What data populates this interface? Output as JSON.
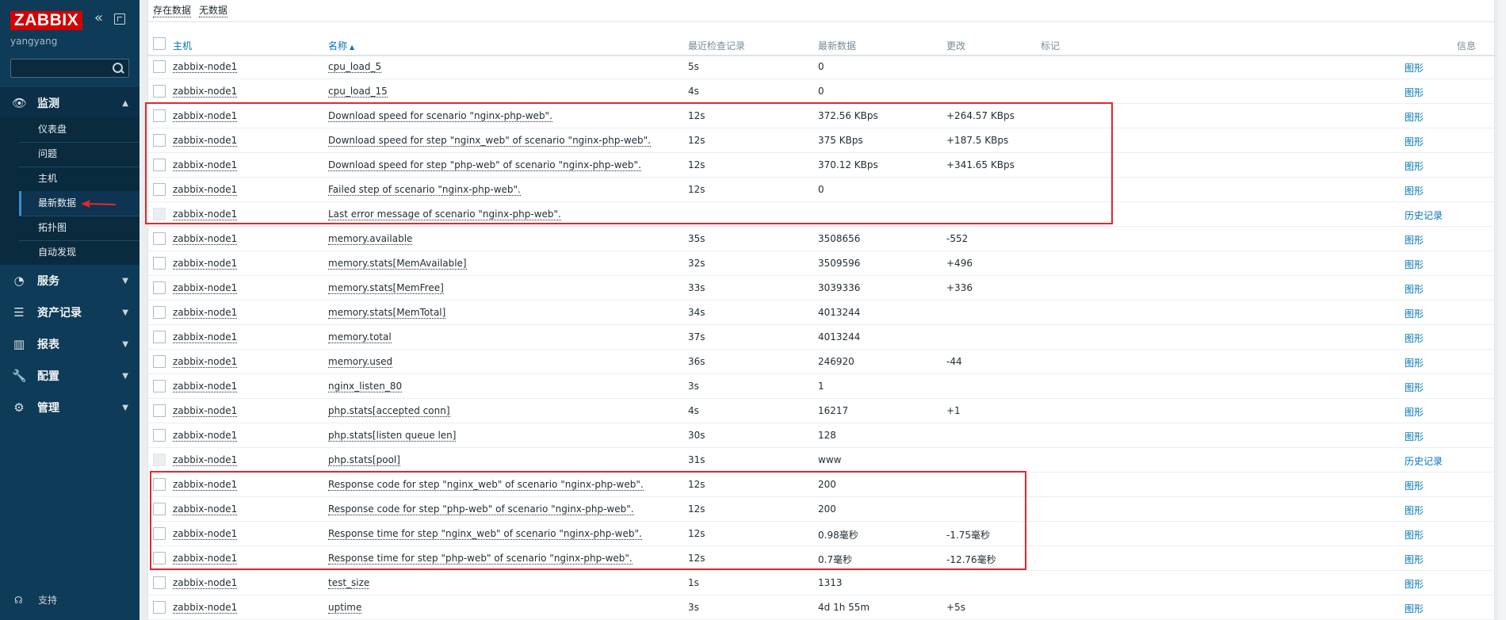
{
  "sidebar": {
    "logo": "ZABBIX",
    "username": "yangyang",
    "search_placeholder": "",
    "sections": [
      {
        "label": "监测",
        "icon": "eye-icon"
      },
      {
        "label": "服务",
        "icon": "clock-icon"
      },
      {
        "label": "资产记录",
        "icon": "list-icon"
      },
      {
        "label": "报表",
        "icon": "chart-icon"
      },
      {
        "label": "配置",
        "icon": "wrench-icon"
      },
      {
        "label": "管理",
        "icon": "gear-icon"
      }
    ],
    "monitoring_items": [
      {
        "label": "仪表盘"
      },
      {
        "label": "问题"
      },
      {
        "label": "主机"
      },
      {
        "label": "最新数据"
      },
      {
        "label": "拓扑图"
      },
      {
        "label": "自动发现"
      }
    ],
    "support_label": "支持"
  },
  "topbar": {
    "with_data_label": "存在数据",
    "without_data_label": "无数据"
  },
  "table": {
    "headers": {
      "host": "主机",
      "name": "名称",
      "last_check": "最近检查记录",
      "last_value": "最新数据",
      "change": "更改",
      "tags": "标记",
      "info": "信息"
    },
    "rows": [
      {
        "host": "zabbix-node1",
        "name": "cpu_load_5",
        "check": "5s",
        "value": "0",
        "change": "",
        "action": "图形"
      },
      {
        "host": "zabbix-node1",
        "name": "cpu_load_15",
        "check": "4s",
        "value": "0",
        "change": "",
        "action": "图形"
      },
      {
        "host": "zabbix-node1",
        "name": "Download speed for scenario \"nginx-php-web\".",
        "check": "12s",
        "value": "372.56 KBps",
        "change": "+264.57 KBps",
        "action": "图形"
      },
      {
        "host": "zabbix-node1",
        "name": "Download speed for step \"nginx_web\" of scenario \"nginx-php-web\".",
        "check": "12s",
        "value": "375 KBps",
        "change": "+187.5 KBps",
        "action": "图形"
      },
      {
        "host": "zabbix-node1",
        "name": "Download speed for step \"php-web\" of scenario \"nginx-php-web\".",
        "check": "12s",
        "value": "370.12 KBps",
        "change": "+341.65 KBps",
        "action": "图形"
      },
      {
        "host": "zabbix-node1",
        "name": "Failed step of scenario \"nginx-php-web\".",
        "check": "12s",
        "value": "0",
        "change": "",
        "action": "图形"
      },
      {
        "host": "zabbix-node1",
        "name": "Last error message of scenario \"nginx-php-web\".",
        "check": "",
        "value": "",
        "change": "",
        "action": "历史记录"
      },
      {
        "host": "zabbix-node1",
        "name": "memory.available",
        "check": "35s",
        "value": "3508656",
        "change": "-552",
        "action": "图形"
      },
      {
        "host": "zabbix-node1",
        "name": "memory.stats[MemAvailable]",
        "check": "32s",
        "value": "3509596",
        "change": "+496",
        "action": "图形"
      },
      {
        "host": "zabbix-node1",
        "name": "memory.stats[MemFree]",
        "check": "33s",
        "value": "3039336",
        "change": "+336",
        "action": "图形"
      },
      {
        "host": "zabbix-node1",
        "name": "memory.stats[MemTotal]",
        "check": "34s",
        "value": "4013244",
        "change": "",
        "action": "图形"
      },
      {
        "host": "zabbix-node1",
        "name": "memory.total",
        "check": "37s",
        "value": "4013244",
        "change": "",
        "action": "图形"
      },
      {
        "host": "zabbix-node1",
        "name": "memory.used",
        "check": "36s",
        "value": "246920",
        "change": "-44",
        "action": "图形"
      },
      {
        "host": "zabbix-node1",
        "name": "nginx_listen_80",
        "check": "3s",
        "value": "1",
        "change": "",
        "action": "图形"
      },
      {
        "host": "zabbix-node1",
        "name": "php.stats[accepted conn]",
        "check": "4s",
        "value": "16217",
        "change": "+1",
        "action": "图形"
      },
      {
        "host": "zabbix-node1",
        "name": "php.stats[listen queue len]",
        "check": "30s",
        "value": "128",
        "change": "",
        "action": "图形"
      },
      {
        "host": "zabbix-node1",
        "name": "php.stats[pool]",
        "check": "31s",
        "value": "www",
        "change": "",
        "action": "历史记录"
      },
      {
        "host": "zabbix-node1",
        "name": "Response code for step \"nginx_web\" of scenario \"nginx-php-web\".",
        "check": "12s",
        "value": "200",
        "change": "",
        "action": "图形"
      },
      {
        "host": "zabbix-node1",
        "name": "Response code for step \"php-web\" of scenario \"nginx-php-web\".",
        "check": "12s",
        "value": "200",
        "change": "",
        "action": "图形"
      },
      {
        "host": "zabbix-node1",
        "name": "Response time for step \"nginx_web\" of scenario \"nginx-php-web\".",
        "check": "12s",
        "value": "0.98毫秒",
        "change": "-1.75毫秒",
        "action": "图形"
      },
      {
        "host": "zabbix-node1",
        "name": "Response time for step \"php-web\" of scenario \"nginx-php-web\".",
        "check": "12s",
        "value": "0.7毫秒",
        "change": "-12.76毫秒",
        "action": "图形"
      },
      {
        "host": "zabbix-node1",
        "name": "test_size",
        "check": "1s",
        "value": "1313",
        "change": "",
        "action": "图形"
      },
      {
        "host": "zabbix-node1",
        "name": "uptime",
        "check": "3s",
        "value": "4d 1h 55m",
        "change": "+5s",
        "action": "图形"
      }
    ]
  },
  "colors": {
    "sidebar_bg": "#0e3b57",
    "logo_red": "#d40000",
    "link_blue": "#0275b8",
    "highlight_red": "#e3272d"
  }
}
